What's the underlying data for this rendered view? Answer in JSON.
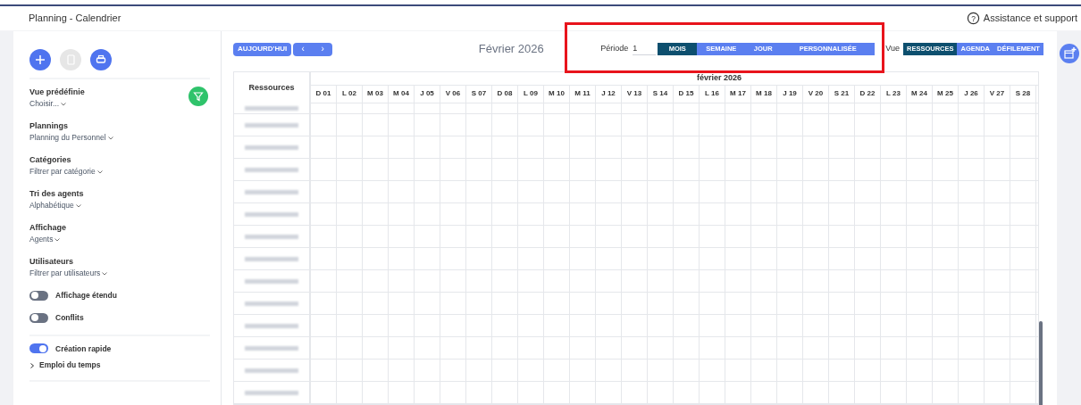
{
  "breadcrumb": "Planning - Calendrier",
  "help_link": "Assistance et support",
  "help_icon": "?",
  "toolbar": [
    {
      "kind": "add",
      "disabled": false
    },
    {
      "kind": "copy",
      "disabled": true
    },
    {
      "kind": "print",
      "disabled": false
    }
  ],
  "filters": [
    {
      "label": "Vue prédéfinie",
      "value": "Choisir..."
    },
    {
      "label": "Plannings",
      "value": "Planning du Personnel"
    },
    {
      "label": "Catégories",
      "value": "Filtrer par catégorie"
    },
    {
      "label": "Tri des agents",
      "value": "Alphabétique"
    },
    {
      "label": "Affichage",
      "value": "Agents"
    },
    {
      "label": "Utilisateurs",
      "value": "Filtrer par utilisateurs"
    }
  ],
  "toggles": [
    {
      "label": "Affichage étendu",
      "on": false
    },
    {
      "label": "Conflits",
      "on": false
    },
    {
      "label": "Création rapide",
      "on": true
    }
  ],
  "schedule_section": {
    "label": "Emploi du temps",
    "expanded": false
  },
  "today_button": "AUJOURD'HUI",
  "nav": [
    "‹",
    "›"
  ],
  "month_title": "Février 2026",
  "period": {
    "label": "Période",
    "value": "1"
  },
  "period_tabs": [
    {
      "label": "MOIS",
      "selected": true
    },
    {
      "label": "SEMAINE",
      "selected": false
    },
    {
      "label": "JOUR",
      "selected": false
    },
    {
      "label": "PERSONNALISÉE",
      "selected": false
    }
  ],
  "view": {
    "label": "Vue",
    "tabs": [
      {
        "label": "RESSOURCES",
        "selected": true
      },
      {
        "label": "AGENDA",
        "selected": false
      },
      {
        "label": "DÉFILEMENT",
        "selected": false
      }
    ]
  },
  "highlight": true,
  "grid": {
    "resource_header": "Ressources",
    "month_header": "février 2026",
    "days": [
      "D 01",
      "L 02",
      "M 03",
      "M 04",
      "J 05",
      "V 06",
      "S 07",
      "D 08",
      "L 09",
      "M 10",
      "M 11",
      "J 12",
      "V 13",
      "S 14",
      "D 15",
      "L 16",
      "M 17",
      "M 18",
      "J 19",
      "V 20",
      "S 21",
      "D 22",
      "L 23",
      "M 24",
      "M 25",
      "J 26",
      "V 27",
      "S 28"
    ],
    "rows": [
      {
        "redacted": true
      },
      {
        "redacted": true
      },
      {
        "redacted": true
      },
      {
        "redacted": true
      },
      {
        "redacted": true
      },
      {
        "redacted": true
      },
      {
        "redacted": true
      },
      {
        "redacted": true
      },
      {
        "redacted": true
      },
      {
        "redacted": true
      },
      {
        "redacted": true
      },
      {
        "redacted": true
      },
      {
        "redacted": true
      },
      {
        "redacted": true
      }
    ]
  }
}
